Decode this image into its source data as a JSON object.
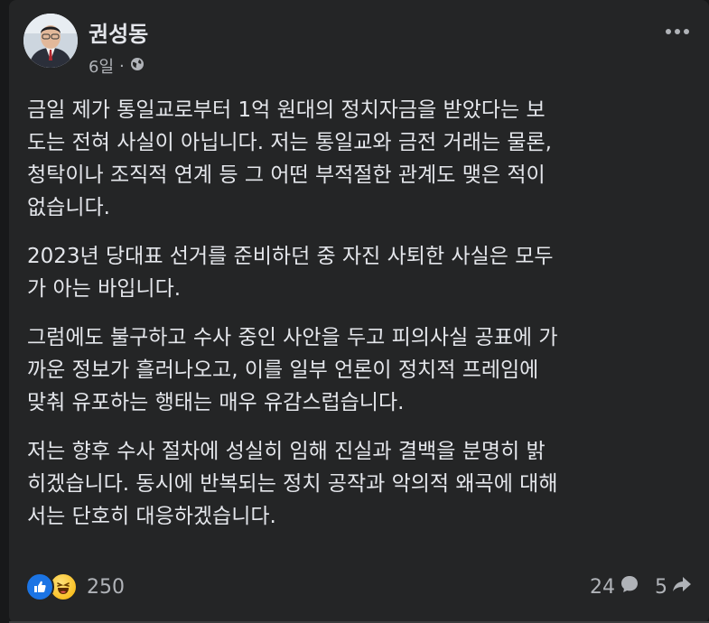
{
  "post": {
    "author": "권성동",
    "time": "6일",
    "separator": "·",
    "privacy_icon": "globe-icon",
    "paragraphs": [
      "금일 제가 통일교로부터 1억 원대의 정치자금을 받았다는 보\n도는 전혀 사실이 아닙니다. 저는 통일교와 금전 거래는 물론,\n청탁이나 조직적 연계 등 그 어떤 부적절한 관계도 맺은 적이\n없습니다.",
      "2023년 당대표 선거를 준비하던 중 자진 사퇴한 사실은 모두\n가 아는 바입니다.",
      "그럼에도 불구하고 수사 중인 사안을 두고 피의사실 공표에 가\n까운 정보가 흘러나오고, 이를 일부 언론이 정치적 프레임에\n맞춰 유포하는 행태는 매우 유감스럽습니다.",
      "저는 향후 수사 절차에 성실히 임해 진실과 결백을 분명히 밝\n히겠습니다. 동시에 반복되는 정치 공작과 악의적 왜곡에 대해\n서는 단호히 대응하겠습니다."
    ]
  },
  "footer": {
    "reactions_icons": [
      "like-icon",
      "haha-icon"
    ],
    "reactions_count": "250",
    "comments_count": "24",
    "shares_count": "5"
  },
  "colors": {
    "background": "#242526",
    "text": "#e4e6eb",
    "secondary_text": "#b0b3b8",
    "like_blue": "#1b74e4"
  }
}
